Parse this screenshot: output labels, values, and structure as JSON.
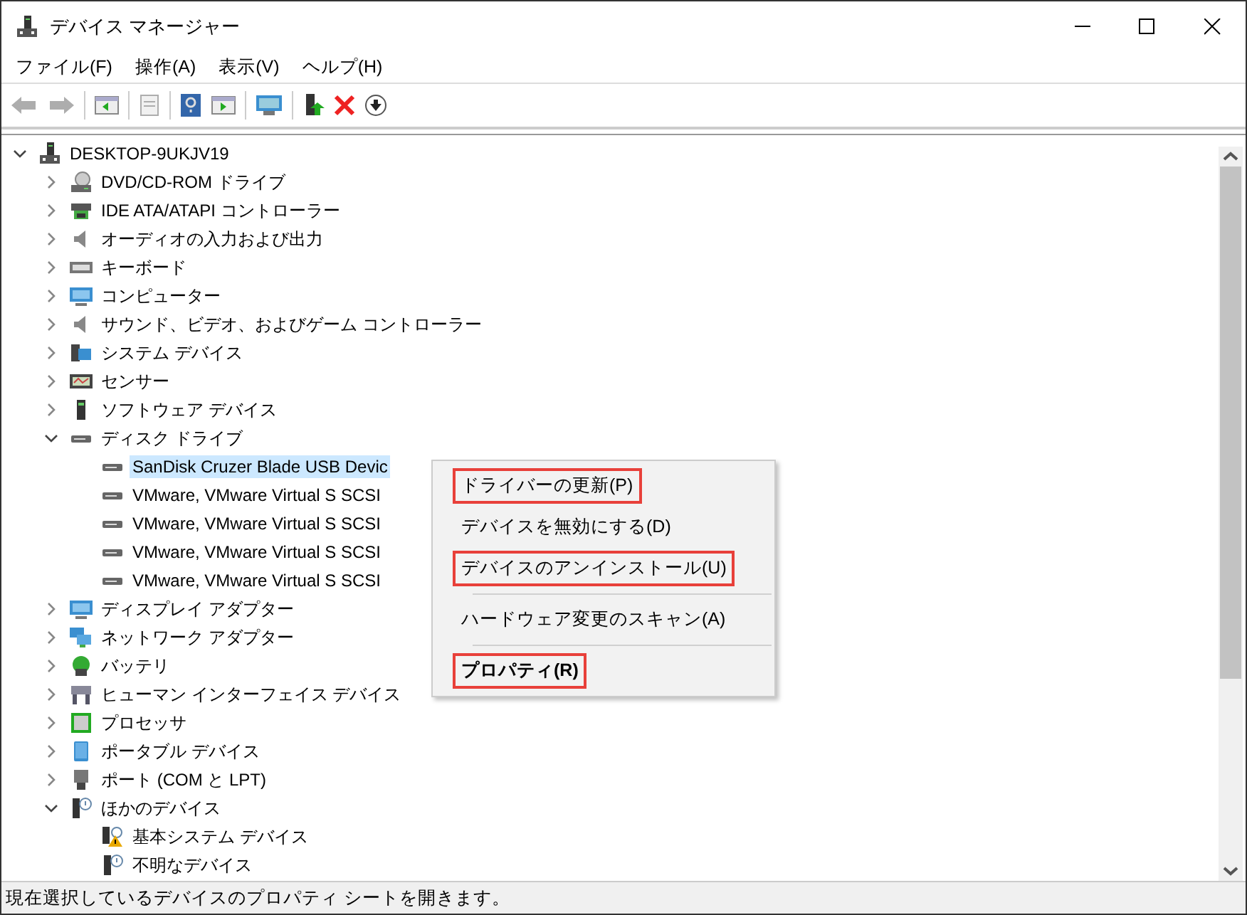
{
  "window": {
    "title": "デバイス マネージャー"
  },
  "menu_bar": [
    {
      "label": "ファイル(F)"
    },
    {
      "label": "操作(A)"
    },
    {
      "label": "表示(V)"
    },
    {
      "label": "ヘルプ(H)"
    }
  ],
  "toolbar": [
    {
      "kind": "back",
      "disabled": true
    },
    {
      "kind": "forward",
      "disabled": true
    },
    {
      "kind": "separator"
    },
    {
      "kind": "console"
    },
    {
      "kind": "separator"
    },
    {
      "kind": "properties",
      "disabled": true
    },
    {
      "kind": "separator"
    },
    {
      "kind": "help"
    },
    {
      "kind": "action-pane"
    },
    {
      "kind": "separator"
    },
    {
      "kind": "scan"
    },
    {
      "kind": "separator"
    },
    {
      "kind": "update"
    },
    {
      "kind": "uninstall"
    },
    {
      "kind": "download"
    }
  ],
  "tree": [
    {
      "label": "DESKTOP-9UKJV19",
      "expanded": true,
      "selected": false,
      "children": [
        {
          "label": "DVD/CD-ROM ドライブ",
          "expanded": false,
          "selected": false
        },
        {
          "label": "IDE ATA/ATAPI コントローラー",
          "expanded": false,
          "selected": false
        },
        {
          "label": "オーディオの入力および出力",
          "expanded": false,
          "selected": false
        },
        {
          "label": "キーボード",
          "expanded": false,
          "selected": false
        },
        {
          "label": "コンピューター",
          "expanded": false,
          "selected": false
        },
        {
          "label": "サウンド、ビデオ、およびゲーム コントローラー",
          "expanded": false,
          "selected": false
        },
        {
          "label": "システム デバイス",
          "expanded": false,
          "selected": false
        },
        {
          "label": "センサー",
          "expanded": false,
          "selected": false
        },
        {
          "label": "ソフトウェア デバイス",
          "expanded": false,
          "selected": false
        },
        {
          "label": "ディスク ドライブ",
          "expanded": true,
          "selected": false,
          "children": [
            {
              "label": "SanDisk Cruzer Blade USB Devic",
              "selected": true
            },
            {
              "label": "VMware, VMware Virtual S SCSI",
              "selected": false
            },
            {
              "label": "VMware, VMware Virtual S SCSI",
              "selected": false
            },
            {
              "label": "VMware, VMware Virtual S SCSI",
              "selected": false
            },
            {
              "label": "VMware, VMware Virtual S SCSI",
              "selected": false
            }
          ]
        },
        {
          "label": "ディスプレイ アダプター",
          "expanded": false,
          "selected": false
        },
        {
          "label": "ネットワーク アダプター",
          "expanded": false,
          "selected": false
        },
        {
          "label": "バッテリ",
          "expanded": false,
          "selected": false
        },
        {
          "label": "ヒューマン インターフェイス デバイス",
          "expanded": false,
          "selected": false
        },
        {
          "label": "プロセッサ",
          "expanded": false,
          "selected": false
        },
        {
          "label": "ポータブル デバイス",
          "expanded": false,
          "selected": false
        },
        {
          "label": "ポート (COM と LPT)",
          "expanded": false,
          "selected": false
        },
        {
          "label": "ほかのデバイス",
          "expanded": true,
          "selected": false,
          "children": [
            {
              "label": "基本システム デバイス",
              "selected": false
            },
            {
              "label": "不明なデバイス",
              "selected": false
            }
          ]
        }
      ]
    }
  ],
  "context_menu": {
    "items": [
      {
        "kind": "item",
        "label": "ドライバーの更新(P)",
        "highlighted": true,
        "default": false
      },
      {
        "kind": "item",
        "label": "デバイスを無効にする(D)",
        "highlighted": false,
        "default": false
      },
      {
        "kind": "item",
        "label": "デバイスのアンインストール(U)",
        "highlighted": true,
        "default": false
      },
      {
        "kind": "separator"
      },
      {
        "kind": "item",
        "label": "ハードウェア変更のスキャン(A)",
        "highlighted": false,
        "default": false
      },
      {
        "kind": "separator"
      },
      {
        "kind": "item",
        "label": "プロパティ(R)",
        "highlighted": true,
        "default": true
      }
    ]
  },
  "status_bar": {
    "text": "現在選択しているデバイスのプロパティ シートを開きます。"
  }
}
